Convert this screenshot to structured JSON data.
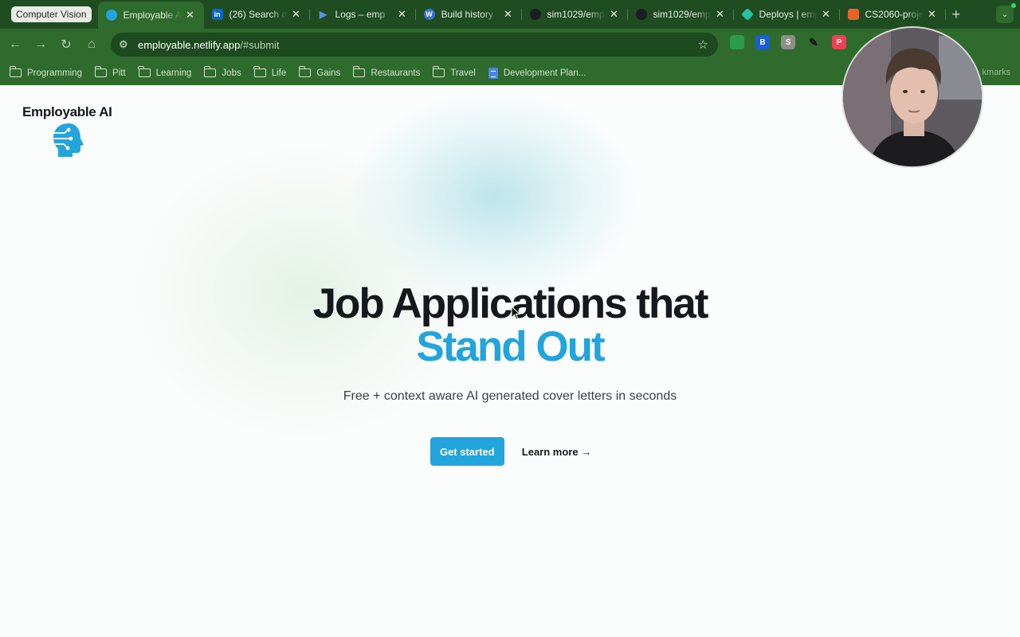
{
  "browser": {
    "tab_group_label": "Computer Vision",
    "tabs": [
      {
        "title": "Employable AI",
        "active": true,
        "favicon_color": "#22a4dc",
        "favicon_glyph": "globe"
      },
      {
        "title": "(26) Search a",
        "active": false,
        "favicon_color": "#0a66c2",
        "favicon_glyph": "in"
      },
      {
        "title": "Logs – emp",
        "active": false,
        "favicon_color": "#3b6fd4",
        "favicon_glyph": "play"
      },
      {
        "title": "Build history",
        "active": false,
        "favicon_color": "#3a6fd8",
        "favicon_glyph": "wp"
      },
      {
        "title": "sim1029/emp",
        "active": false,
        "favicon_color": "#1b1f23",
        "favicon_glyph": "github"
      },
      {
        "title": "sim1029/emp",
        "active": false,
        "favicon_color": "#1b1f23",
        "favicon_glyph": "github"
      },
      {
        "title": "Deploys | emp",
        "active": false,
        "favicon_color": "#25c2a0",
        "favicon_glyph": "diamond"
      },
      {
        "title": "CS2060-proje",
        "active": false,
        "favicon_color": "#e8622c",
        "favicon_glyph": "gitlab"
      }
    ],
    "new_tab_label": "+",
    "url_host": "employable.netlify.app",
    "url_path": "/#submit",
    "bookmarks": [
      {
        "label": "Programming",
        "type": "folder"
      },
      {
        "label": "Pitt",
        "type": "folder"
      },
      {
        "label": "Learning",
        "type": "folder"
      },
      {
        "label": "Jobs",
        "type": "folder"
      },
      {
        "label": "Life",
        "type": "folder"
      },
      {
        "label": "Gains",
        "type": "folder"
      },
      {
        "label": "Restaurants",
        "type": "folder"
      },
      {
        "label": "Travel",
        "type": "folder"
      },
      {
        "label": "Development Plan...",
        "type": "doc"
      }
    ],
    "bookmarks_right_label": "kmarks"
  },
  "site": {
    "brand_name": "Employable AI",
    "headline_line1": "Job Applications that",
    "headline_line2": "Stand Out",
    "subtitle": "Free + context aware AI generated cover letters in seconds",
    "primary_cta": "Get started",
    "secondary_cta": "Learn more →",
    "accent_color": "#22a4dc"
  }
}
